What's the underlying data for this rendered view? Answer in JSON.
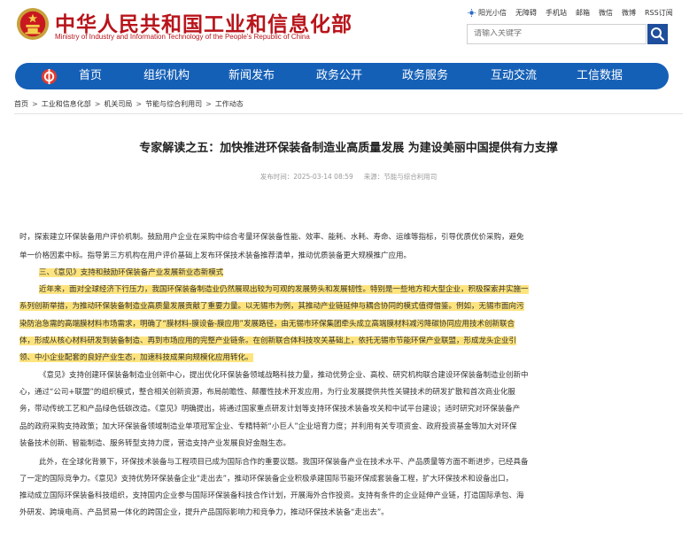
{
  "header": {
    "site_title": "中华人民共和国工业和信息化部",
    "site_subtitle": "Ministry of Industry and Information Technology of the People's Republic of China",
    "top_links": [
      "阳光小信",
      "无障碍",
      "手机站",
      "邮箱",
      "微信",
      "微博",
      "RSS订阅"
    ],
    "search_placeholder": "请输入关键字"
  },
  "nav": {
    "items": [
      "首页",
      "组织机构",
      "新闻发布",
      "政务公开",
      "政务服务",
      "互动交流",
      "工信数据"
    ]
  },
  "breadcrumb": [
    "首页",
    "工业和信息化部",
    "机关司局",
    "节能与综合利用司",
    "工作动态"
  ],
  "article": {
    "title": "专家解读之五：加快推进环保装备制造业高质量发展 为建设美丽中国提供有力支撑",
    "date_label": "发布时间：",
    "date": "2025-03-14 08:59",
    "source_label": "来源：",
    "source": "节能与综合利用司",
    "lines": [
      "时，探索建立环保装备用户评价机制。鼓励用户企业在采购中综合考量环保装备性能、效率、能耗、水耗、寿命、运维等指标，引导优质优价采购，避免",
      "单一价格因素中标。指导第三方机构在用户评价基础上发布环保技术装备推荐清单，推动优质装备更大规模推广应用。",
      "三、《意见》支持和鼓励环保装备产业发展新业态新模式",
      "近年来，面对全球经济下行压力，我国环保装备制造业仍然展现出较为可观的发展势头和发展韧性。特别是一些地方和大型企业，积极探索并实施一",
      "系列创新举措，为推动环保装备制造业高质量发展贡献了重要力量。以无锡市为例，其推动产业链延伸与耦合协同的模式值得借鉴。例如，无锡市面向污",
      "染防治急需的高端膜材料市场需求，明确了“膜材料-膜设备-膜应用”发展路径，由无锡市环保集团牵头成立高端膜材料减污降碳协同应用技术创新联合",
      "体，形成从核心材料研发到装备制造、再到市场应用的完整产业链条。在创新联合体科技攻关基础上，依托无锡市节能环保产业联盟，形成龙头企业引",
      "领、中小企业配套的良好产业生态，加速科技成果向规模化应用转化。",
      "《意见》支持创建环保装备制造业创新中心，提出优化环保装备领域战略科技力量，推动优势企业、高校、研究机构联合建设环保装备制造业创新中",
      "心，通过“公司+联盟”的组织模式，整合相关创新资源，布局前瞻性、颠覆性技术开发应用，为行业发展提供共性关键技术的研发扩散和首次商业化服",
      "务，带动传统工艺和产品绿色低碳改造。《意见》明确提出，将通过国家重点研发计划等支持环保技术装备攻关和中试平台建设；适时研究对环保装备产",
      "品的政府采购支持政策；加大环保装备领域制造业单项冠军企业、专精特新“小巨人”企业培育力度；并利用有关专项资金、政府投资基金等加大对环保",
      "装备技术创新、智能制造、服务转型支持力度，营造支持产业发展良好金融生态。",
      "此外，在全球化背景下，环保技术装备与工程项目已成为国际合作的重要议题。我国环保装备产业在技术水平、产品质量等方面不断进步，已经具备",
      "了一定的国际竞争力。《意见》支持优势环保装备企业“走出去”，推动环保装备企业积极承建国际节能环保成套装备工程，扩大环保技术和设备出口，",
      "推动成立国际环保装备科技组织，支持国内企业参与国际环保装备科技合作计划，开展海外合作投资。支持有条件的企业延伸产业链，打造国际承包、海",
      "外研发、跨境电商、产品贸易一体化的跨国企业，提升产品国际影响力和竞争力，推动环保技术装备“走出去”。"
    ]
  },
  "colors": {
    "brand_red": "#b8141b",
    "nav_blue": "#1560b7",
    "search_button": "#1f4e9c",
    "highlight_yellow": "#fde47f",
    "highlight_green": "#cdeca2"
  }
}
